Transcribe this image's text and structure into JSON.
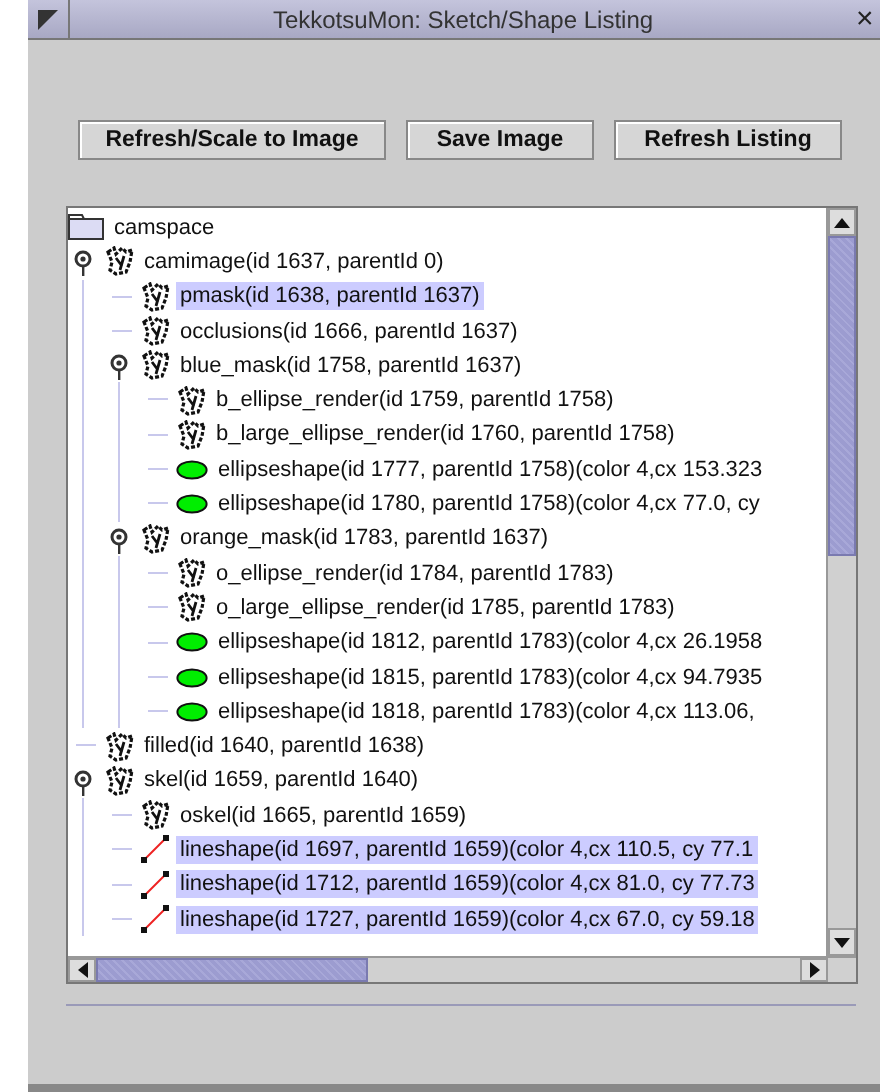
{
  "window": {
    "title": "TekkotsuMon: Sketch/Shape Listing",
    "close_glyph": "×"
  },
  "buttons": [
    "Refresh/Scale to Image",
    "Save Image",
    "Refresh Listing"
  ],
  "tree": {
    "nodes": [
      {
        "label": "camspace",
        "kind": "folder",
        "selected": false,
        "children": [
          {
            "label": "camimage(id 1637, parentId 0)",
            "kind": "sketch",
            "selected": false,
            "expanded": true,
            "children": [
              {
                "label": "pmask(id 1638, parentId 1637)",
                "kind": "sketch",
                "selected": true,
                "expanded": false
              },
              {
                "label": "occlusions(id 1666, parentId 1637)",
                "kind": "sketch",
                "selected": false,
                "expanded": false
              },
              {
                "label": "blue_mask(id 1758, parentId 1637)",
                "kind": "sketch",
                "selected": false,
                "expanded": true,
                "children": [
                  {
                    "label": "b_ellipse_render(id 1759, parentId 1758)",
                    "kind": "sketch",
                    "selected": false,
                    "expanded": false
                  },
                  {
                    "label": "b_large_ellipse_render(id 1760, parentId 1758)",
                    "kind": "sketch",
                    "selected": false,
                    "expanded": false
                  },
                  {
                    "label": "ellipseshape(id 1777, parentId 1758)(color 4,cx 153.323",
                    "kind": "ellipse",
                    "selected": false,
                    "expanded": false
                  },
                  {
                    "label": "ellipseshape(id 1780, parentId 1758)(color 4,cx 77.0, cy",
                    "kind": "ellipse",
                    "selected": false,
                    "expanded": false
                  }
                ]
              },
              {
                "label": "orange_mask(id 1783, parentId 1637)",
                "kind": "sketch",
                "selected": false,
                "expanded": true,
                "children": [
                  {
                    "label": "o_ellipse_render(id 1784, parentId 1783)",
                    "kind": "sketch",
                    "selected": false,
                    "expanded": false
                  },
                  {
                    "label": "o_large_ellipse_render(id 1785, parentId 1783)",
                    "kind": "sketch",
                    "selected": false,
                    "expanded": false
                  },
                  {
                    "label": "ellipseshape(id 1812, parentId 1783)(color 4,cx 26.1958",
                    "kind": "ellipse",
                    "selected": false,
                    "expanded": false
                  },
                  {
                    "label": "ellipseshape(id 1815, parentId 1783)(color 4,cx 94.7935",
                    "kind": "ellipse",
                    "selected": false,
                    "expanded": false
                  },
                  {
                    "label": "ellipseshape(id 1818, parentId 1783)(color 4,cx 113.06,",
                    "kind": "ellipse",
                    "selected": false,
                    "expanded": false
                  }
                ]
              }
            ]
          },
          {
            "label": "filled(id 1640, parentId 1638)",
            "kind": "sketch",
            "selected": false,
            "expanded": false
          },
          {
            "label": "skel(id 1659, parentId 1640)",
            "kind": "sketch",
            "selected": false,
            "expanded": true,
            "children": [
              {
                "label": "oskel(id 1665, parentId 1659)",
                "kind": "sketch",
                "selected": false,
                "expanded": false
              },
              {
                "label": "lineshape(id 1697, parentId 1659)(color 4,cx 110.5, cy 77.1",
                "kind": "line",
                "selected": true,
                "expanded": false
              },
              {
                "label": "lineshape(id 1712, parentId 1659)(color 4,cx 81.0, cy 77.73",
                "kind": "line",
                "selected": true,
                "expanded": false
              },
              {
                "label": "lineshape(id 1727, parentId 1659)(color 4,cx 67.0, cy 59.18",
                "kind": "line",
                "selected": true,
                "expanded": false
              }
            ]
          }
        ]
      }
    ]
  }
}
